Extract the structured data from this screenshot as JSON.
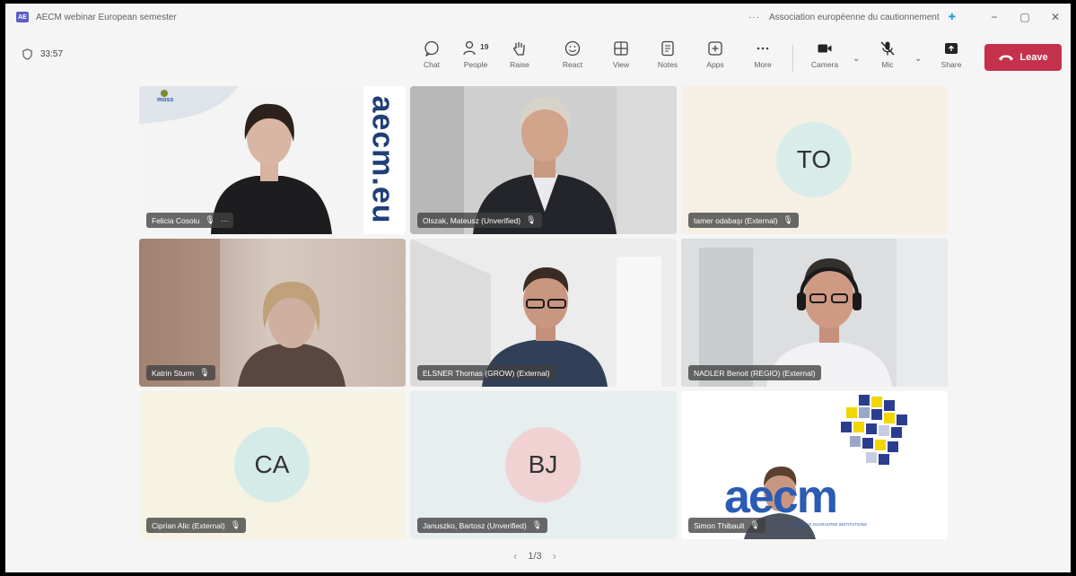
{
  "titlebar": {
    "app_icon_text": "AE",
    "title": "AECM webinar European semester",
    "more": "···",
    "org": "Association européenne du cautionnement",
    "org_icon": "✚",
    "minimize": "−",
    "maximize": "▢",
    "close": "✕"
  },
  "toolbar": {
    "timer": "33:57",
    "people_count": "19",
    "items": [
      {
        "label": "Chat",
        "icon": "chat-icon"
      },
      {
        "label": "People",
        "icon": "people-icon"
      },
      {
        "label": "Raise",
        "icon": "hand-icon"
      },
      {
        "label": "React",
        "icon": "smile-icon"
      },
      {
        "label": "View",
        "icon": "grid-icon"
      },
      {
        "label": "Notes",
        "icon": "notes-icon"
      },
      {
        "label": "Apps",
        "icon": "plus-icon"
      },
      {
        "label": "More",
        "icon": "more-icon"
      },
      {
        "label": "Camera",
        "icon": "camera-icon"
      },
      {
        "label": "Mic",
        "icon": "mic-off-icon"
      },
      {
        "label": "Share",
        "icon": "share-icon"
      }
    ],
    "caret": "⌄",
    "leave_label": "Leave"
  },
  "participants": [
    {
      "name": "Felicia Cosoiu",
      "initials": "",
      "extra": "···"
    },
    {
      "name": "Olszak, Mateusz (Unverified)",
      "initials": ""
    },
    {
      "name": "tamer odabaşı (External)",
      "initials": "TO"
    },
    {
      "name": "Katrin Sturm",
      "initials": ""
    },
    {
      "name": "ELSNER Thomas (GROW) (External)",
      "initials": ""
    },
    {
      "name": "NADLER Benoit (REGIO) (External)",
      "initials": ""
    },
    {
      "name": "Ciprian Alic (External)",
      "initials": "CA"
    },
    {
      "name": "Januszko, Bartosz (Unverified)",
      "initials": "BJ"
    },
    {
      "name": "Simon Thibault",
      "initials": ""
    }
  ],
  "tile_text": {
    "logo_small": "moss",
    "brand_vertical": "aecm.eu",
    "aecm_logo": "aecm",
    "aecm_sub": "EUROPEAN GUARANTEE INSTITUTIONS"
  },
  "mic_icon": "🎙",
  "pager": {
    "prev": "‹",
    "label": "1/3",
    "next": "›"
  },
  "colors": {
    "leave": "#c4314b",
    "active_border": "#6264a7",
    "aecm_blue": "#2b5bb3"
  }
}
